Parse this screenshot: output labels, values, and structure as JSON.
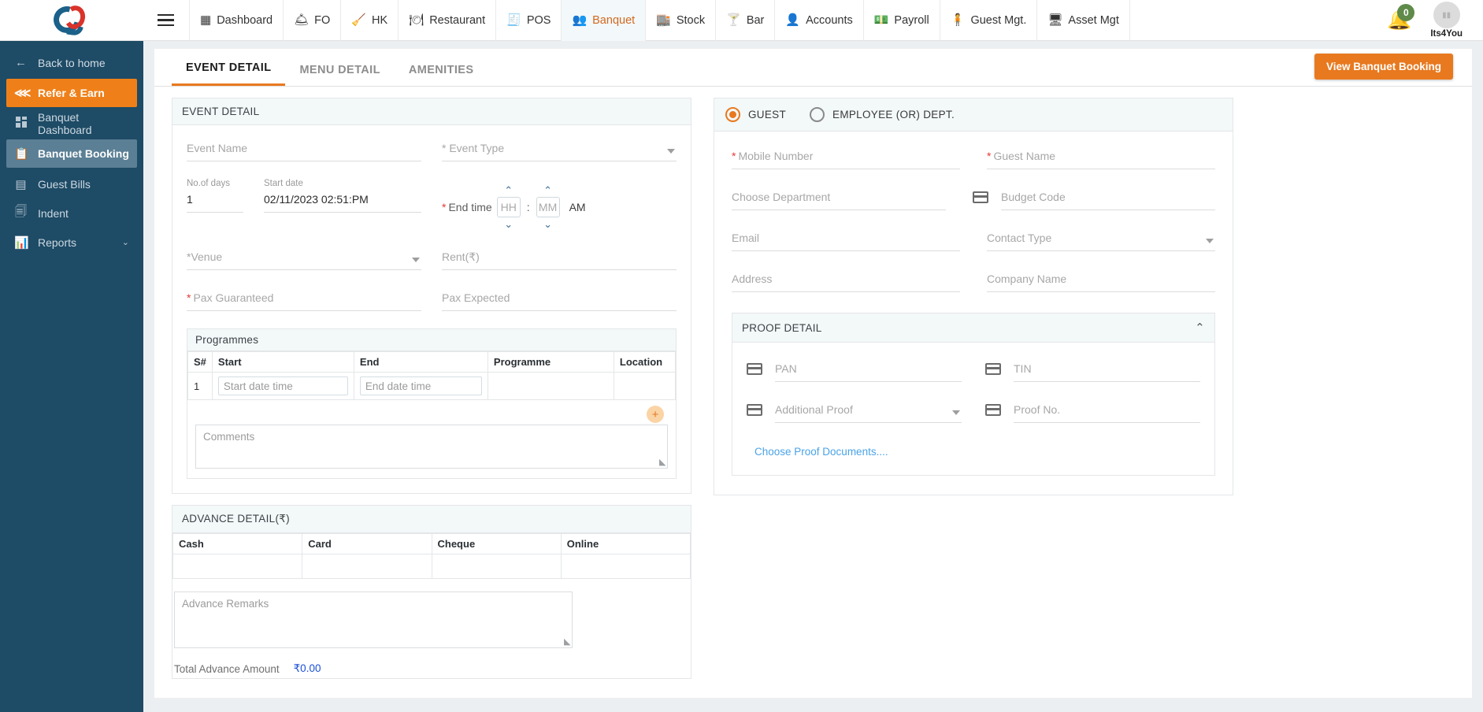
{
  "app": {
    "brand_name": "Q",
    "user_name": "Its4You",
    "notification_count": "0",
    "accent_color": "#e8791f",
    "sidebar_color": "#1e4b66"
  },
  "topnav": {
    "menu_icon": "hamburger-icon",
    "items": [
      {
        "label": "Dashboard",
        "icon": "dashboard-icon",
        "glyph": "▦",
        "active": false
      },
      {
        "label": "FO",
        "icon": "front-office-icon",
        "glyph": "🛎",
        "active": false
      },
      {
        "label": "HK",
        "icon": "housekeeping-icon",
        "glyph": "🧹",
        "active": false
      },
      {
        "label": "Restaurant",
        "icon": "restaurant-icon",
        "glyph": "🍽",
        "active": false
      },
      {
        "label": "POS",
        "icon": "pos-icon",
        "glyph": "🧾",
        "active": false
      },
      {
        "label": "Banquet",
        "icon": "banquet-icon",
        "glyph": "👥",
        "active": true
      },
      {
        "label": "Stock",
        "icon": "stock-icon",
        "glyph": "🏬",
        "active": false
      },
      {
        "label": "Bar",
        "icon": "bar-icon",
        "glyph": "🍸",
        "active": false
      },
      {
        "label": "Accounts",
        "icon": "accounts-icon",
        "glyph": "👤",
        "active": false
      },
      {
        "label": "Payroll",
        "icon": "payroll-icon",
        "glyph": "💵",
        "active": false
      },
      {
        "label": "Guest Mgt.",
        "icon": "guest-management-icon",
        "glyph": "🧍",
        "active": false
      },
      {
        "label": "Asset Mgt",
        "icon": "asset-management-icon",
        "glyph": "🖥",
        "active": false
      }
    ]
  },
  "sidebar": {
    "items": [
      {
        "label": "Back to home",
        "icon": "arrow-left-icon",
        "glyph": "←",
        "state": "back"
      },
      {
        "label": "Refer & Earn",
        "icon": "share-icon",
        "glyph": "⋘",
        "state": "highlight"
      },
      {
        "label": "Banquet Dashboard",
        "icon": "grid-icon",
        "glyph": "",
        "state": "normal"
      },
      {
        "label": "Banquet Booking",
        "icon": "clipboard-icon",
        "glyph": "📋",
        "state": "selected"
      },
      {
        "label": "Guest Bills",
        "icon": "bill-icon",
        "glyph": "▤",
        "state": "normal"
      },
      {
        "label": "Indent",
        "icon": "indent-icon",
        "glyph": "🗐",
        "state": "normal"
      },
      {
        "label": "Reports",
        "icon": "reports-icon",
        "glyph": "📊",
        "state": "normal",
        "chevron": "⌄"
      }
    ]
  },
  "tabs": [
    {
      "label": "EVENT DETAIL",
      "active": true
    },
    {
      "label": "MENU DETAIL",
      "active": false
    },
    {
      "label": "AMENITIES",
      "active": false
    }
  ],
  "header_action": {
    "view_booking_label": "View Banquet Booking"
  },
  "event_detail": {
    "panel_title": "EVENT DETAIL",
    "event_name_placeholder": "Event Name",
    "event_type_placeholder": "Event Type",
    "no_of_days_label": "No.of days",
    "no_of_days_value": "1",
    "start_date_label": "Start date",
    "start_date_value": "02/11/2023 02:51:PM",
    "end_time_label": "End time",
    "end_time_hh": "HH",
    "end_time_mm": "MM",
    "end_time_colon": ":",
    "end_time_meridiem": "AM",
    "venue_placeholder": "*Venue",
    "rent_placeholder": "Rent(₹)",
    "pax_guaranteed_placeholder": "Pax Guaranteed",
    "pax_expected_placeholder": "Pax Expected",
    "comments_placeholder": "Comments",
    "required_star": "*"
  },
  "programmes": {
    "title": "Programmes",
    "columns": [
      "S#",
      "Start",
      "End",
      "Programme",
      "Location"
    ],
    "rows": [
      {
        "sn": "1",
        "start_placeholder": "Start date time",
        "end_placeholder": "End date time",
        "programme": "",
        "location": ""
      }
    ],
    "add_label": "+"
  },
  "advance_detail": {
    "title": "ADVANCE DETAIL(₹)",
    "columns": [
      "Cash",
      "Card",
      "Cheque",
      "Online"
    ],
    "rows": [
      {
        "cash": "",
        "card": "",
        "cheque": "",
        "online": ""
      }
    ],
    "remarks_placeholder": "Advance Remarks",
    "total_label": "Total Advance Amount",
    "total_value": "₹0.00"
  },
  "guest_panel": {
    "radio_guest": "GUEST",
    "radio_employee": "EMPLOYEE (OR) DEPT.",
    "selected": "GUEST",
    "mobile_number_placeholder": "Mobile Number",
    "guest_name_placeholder": "Guest Name",
    "choose_department_placeholder": "Choose Department",
    "budget_code_placeholder": "Budget Code",
    "email_placeholder": "Email",
    "contact_type_placeholder": "Contact Type",
    "address_placeholder": "Address",
    "company_name_placeholder": "Company Name"
  },
  "proof_detail": {
    "title": "PROOF DETAIL",
    "collapse_glyph": "⌃",
    "pan_placeholder": "PAN",
    "tin_placeholder": "TIN",
    "additional_proof_placeholder": "Additional Proof",
    "proof_no_placeholder": "Proof No.",
    "choose_documents_label": "Choose Proof Documents...."
  }
}
